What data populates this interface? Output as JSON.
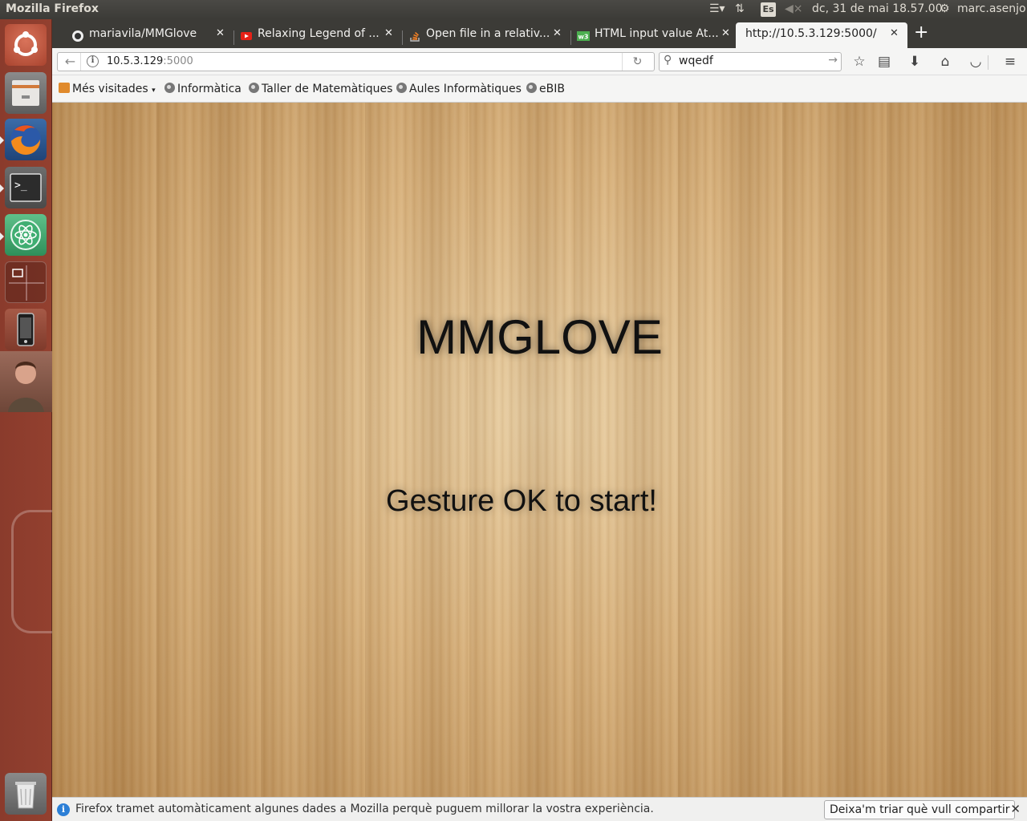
{
  "topbar": {
    "window_title": "Mozilla Firefox",
    "keyboard_layout": "Es",
    "datetime": "dc, 31 de mai 18.57.00",
    "user": "marc.asenjo"
  },
  "launcher": {
    "items": [
      {
        "name": "Ubuntu Dash"
      },
      {
        "name": "Files"
      },
      {
        "name": "Firefox"
      },
      {
        "name": "Terminal"
      },
      {
        "name": "Atom"
      },
      {
        "name": "Workspace Switcher"
      },
      {
        "name": "Phone"
      },
      {
        "name": "User photo"
      },
      {
        "name": "Trash"
      }
    ]
  },
  "tabs": [
    {
      "label": "mariavila/MMGlove",
      "icon": "github-icon"
    },
    {
      "label": "Relaxing Legend of ...",
      "icon": "youtube-icon"
    },
    {
      "label": "Open file in a relativ...",
      "icon": "stackoverflow-icon"
    },
    {
      "label": "HTML input value At...",
      "icon": "w3schools-icon"
    },
    {
      "label": "http://10.5.3.129:5000/",
      "icon": "",
      "active": true
    }
  ],
  "navbar": {
    "url_host": "10.5.3.129",
    "url_port": ":5000",
    "search_value": "wqedf"
  },
  "bookmarks": [
    {
      "label": "Més visitades",
      "has_dropdown": true
    },
    {
      "label": "Informàtica"
    },
    {
      "label": "Taller de Matemàtiques"
    },
    {
      "label": "Aules Informàtiques"
    },
    {
      "label": "eBIB"
    }
  ],
  "page": {
    "title": "MMGLOVE",
    "instruction": "Gesture OK to start!"
  },
  "notification": {
    "message": "Firefox tramet automàticament algunes dades a Mozilla perquè puguem millorar la vostra experiència.",
    "button": "Deixa'm triar què vull compartir"
  },
  "colors": {
    "launcher_bg": "#8a3b2c",
    "panel_bg": "#3c3b37",
    "wood_light": "#e9cfa3",
    "wood_dark": "#b98b52"
  }
}
